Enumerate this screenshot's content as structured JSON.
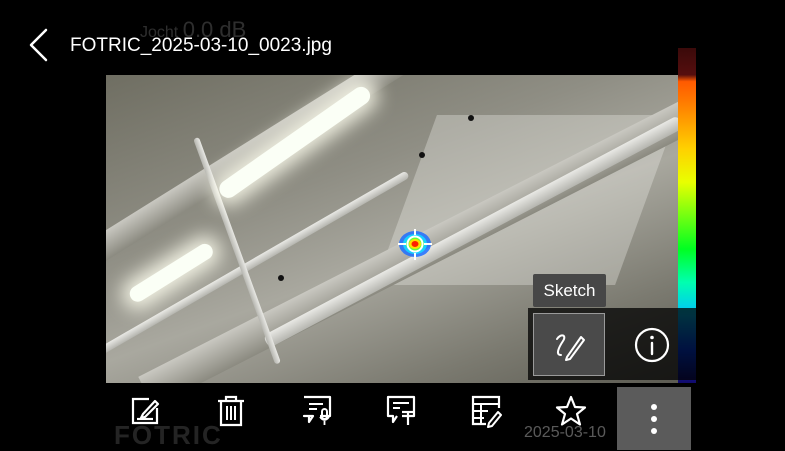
{
  "header": {
    "file_name": "FOTRIC_2025-03-10_0023.jpg",
    "back_icon": "chevron-left-icon"
  },
  "overlay_ghost": {
    "label": "Jocht",
    "value": "0.0 dB"
  },
  "watermark": {
    "logo": "FOTRIC",
    "date": "2025-03-10"
  },
  "tooltip": {
    "sketch": "Sketch"
  },
  "side_panel": {
    "sketch_icon": "sketch-pen-icon",
    "info_icon": "info-icon"
  },
  "toolbar": {
    "items": [
      {
        "icon": "edit-icon"
      },
      {
        "icon": "trash-icon"
      },
      {
        "icon": "voice-note-icon"
      },
      {
        "icon": "text-note-icon"
      },
      {
        "icon": "report-edit-icon"
      },
      {
        "icon": "star-icon"
      },
      {
        "icon": "more-vertical-icon"
      }
    ]
  },
  "colors": {
    "tooltip_bg": "#474747",
    "active_button_bg": "#5b5b5b"
  }
}
